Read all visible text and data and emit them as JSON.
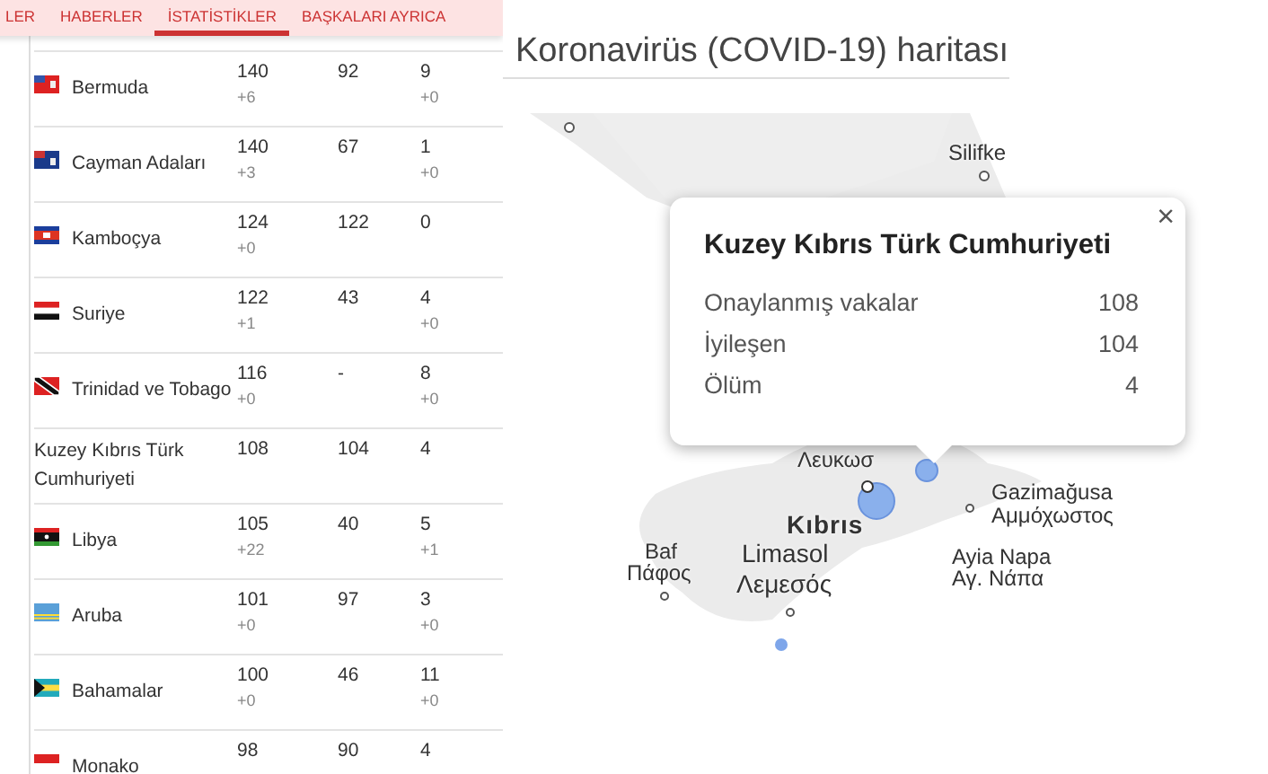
{
  "tabs": [
    {
      "label": "LER",
      "selected": false
    },
    {
      "label": "HABERLER",
      "selected": false
    },
    {
      "label": "İSTATİSTİKLER",
      "selected": true
    },
    {
      "label": "BAŞKALARI AYRICA",
      "selected": false
    }
  ],
  "table": {
    "rows": [
      {
        "kind": "bermuda",
        "name": "Bermuda",
        "cases": "140",
        "cases_delta": "+6",
        "recovered": "92",
        "deaths": "9",
        "deaths_delta": "+0"
      },
      {
        "kind": "cayman",
        "name": "Cayman Adaları",
        "cases": "140",
        "cases_delta": "+3",
        "recovered": "67",
        "deaths": "1",
        "deaths_delta": "+0"
      },
      {
        "kind": "cambodia",
        "name": "Kamboçya",
        "cases": "124",
        "cases_delta": "+0",
        "recovered": "122",
        "deaths": "0"
      },
      {
        "kind": "syria",
        "name": "Suriye",
        "cases": "122",
        "cases_delta": "+1",
        "recovered": "43",
        "deaths": "4",
        "deaths_delta": "+0"
      },
      {
        "kind": "trinidad",
        "name": "Trinidad ve Tobago",
        "cases": "116",
        "cases_delta": "+0",
        "recovered": "-",
        "deaths": "8",
        "deaths_delta": "+0"
      },
      {
        "kind": "plain",
        "name": "Kuzey Kıbrıs Türk Cumhuriyeti",
        "cases": "108",
        "recovered": "104",
        "deaths": "4"
      },
      {
        "kind": "libya",
        "name": "Libya",
        "cases": "105",
        "cases_delta": "+22",
        "recovered": "40",
        "deaths": "5",
        "deaths_delta": "+1"
      },
      {
        "kind": "aruba",
        "name": "Aruba",
        "cases": "101",
        "cases_delta": "+0",
        "recovered": "97",
        "deaths": "3",
        "deaths_delta": "+0"
      },
      {
        "kind": "bahamas",
        "name": "Bahamalar",
        "cases": "100",
        "cases_delta": "+0",
        "recovered": "46",
        "deaths": "11",
        "deaths_delta": "+0"
      },
      {
        "kind": "monaco",
        "name": "Monako",
        "cases": "98",
        "recovered": "90",
        "deaths": "4"
      }
    ]
  },
  "map": {
    "title": "Koronavirüs (COVID-19) haritası",
    "labels": [
      {
        "text": "Silifke",
        "kind": "town"
      },
      {
        "text": "Λευκωσ",
        "kind": "town"
      },
      {
        "text": "Kıbrıs",
        "kind": "country"
      },
      {
        "text": "Gazimağusa",
        "kind": "town"
      },
      {
        "text": "Αμμόχωστος",
        "kind": "town"
      },
      {
        "text": "Baf",
        "kind": "town"
      },
      {
        "text": "Πάφος",
        "kind": "town"
      },
      {
        "text": "Limasol",
        "kind": "city"
      },
      {
        "text": "Λεμεσός",
        "kind": "city"
      },
      {
        "text": "Ayia Napa",
        "kind": "town"
      },
      {
        "text": "Αγ. Νάπα",
        "kind": "town"
      }
    ],
    "popup": {
      "title": "Kuzey Kıbrıs Türk Cumhuriyeti",
      "close": "×",
      "stats": [
        {
          "label": "Onaylanmış vakalar",
          "value": "108"
        },
        {
          "label": "İyileşen",
          "value": "104"
        },
        {
          "label": "Ölüm",
          "value": "4"
        }
      ]
    }
  }
}
